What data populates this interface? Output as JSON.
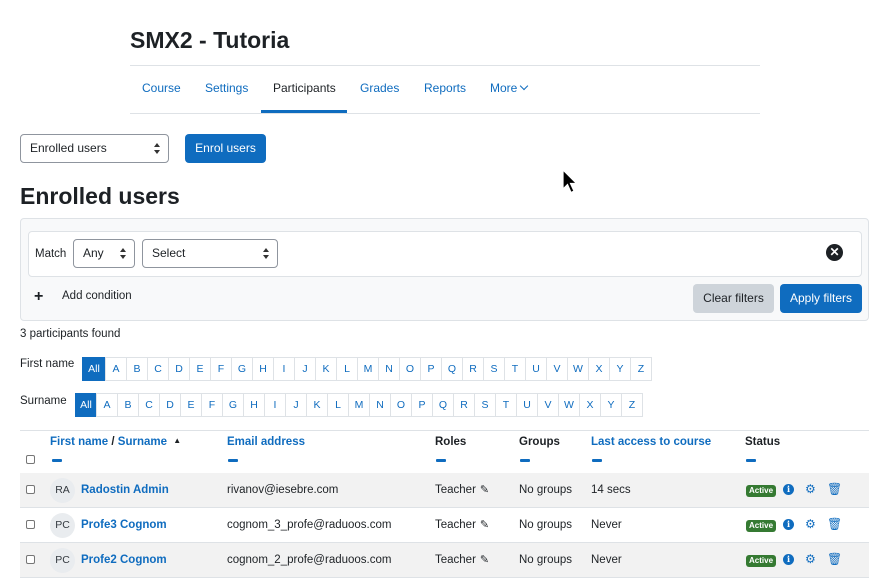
{
  "course": {
    "title": "SMX2 - Tutoria"
  },
  "nav": {
    "tabs": [
      {
        "label": "Course"
      },
      {
        "label": "Settings"
      },
      {
        "label": "Participants",
        "active": true
      },
      {
        "label": "Grades"
      },
      {
        "label": "Reports"
      },
      {
        "label": "More"
      }
    ]
  },
  "toolbar": {
    "page_select_value": "Enrolled users",
    "enrol_button": "Enrol users"
  },
  "page": {
    "heading": "Enrolled users"
  },
  "filters": {
    "match_label": "Match",
    "match_value": "Any",
    "type_value": "Select",
    "add_condition": "Add condition",
    "clear_button": "Clear filters",
    "apply_button": "Apply filters"
  },
  "participants_count": "3 participants found",
  "initials_bar": {
    "first_name_label": "First name",
    "surname_label": "Surname",
    "letters": [
      "All",
      "A",
      "B",
      "C",
      "D",
      "E",
      "F",
      "G",
      "H",
      "I",
      "J",
      "K",
      "L",
      "M",
      "N",
      "O",
      "P",
      "Q",
      "R",
      "S",
      "T",
      "U",
      "V",
      "W",
      "X",
      "Y",
      "Z"
    ]
  },
  "table": {
    "headers": {
      "first_name": "First name",
      "separator": "/",
      "surname": "Surname",
      "email": "Email address",
      "roles": "Roles",
      "groups": "Groups",
      "last_access": "Last access to course",
      "status": "Status"
    },
    "rows": [
      {
        "initials": "RA",
        "name": "Radostin Admin",
        "email": "rivanov@iesebre.com",
        "role": "Teacher",
        "groups": "No groups",
        "last_access": "14 secs",
        "status": "Active"
      },
      {
        "initials": "PC",
        "name": "Profe3 Cognom",
        "email": "cognom_3_profe@raduoos.com",
        "role": "Teacher",
        "groups": "No groups",
        "last_access": "Never",
        "status": "Active"
      },
      {
        "initials": "PC",
        "name": "Profe2 Cognom",
        "email": "cognom_2_profe@raduoos.com",
        "role": "Teacher",
        "groups": "No groups",
        "last_access": "Never",
        "status": "Active"
      }
    ]
  },
  "colors": {
    "primary": "#0f6cbf",
    "active_badge": "#357a32"
  }
}
